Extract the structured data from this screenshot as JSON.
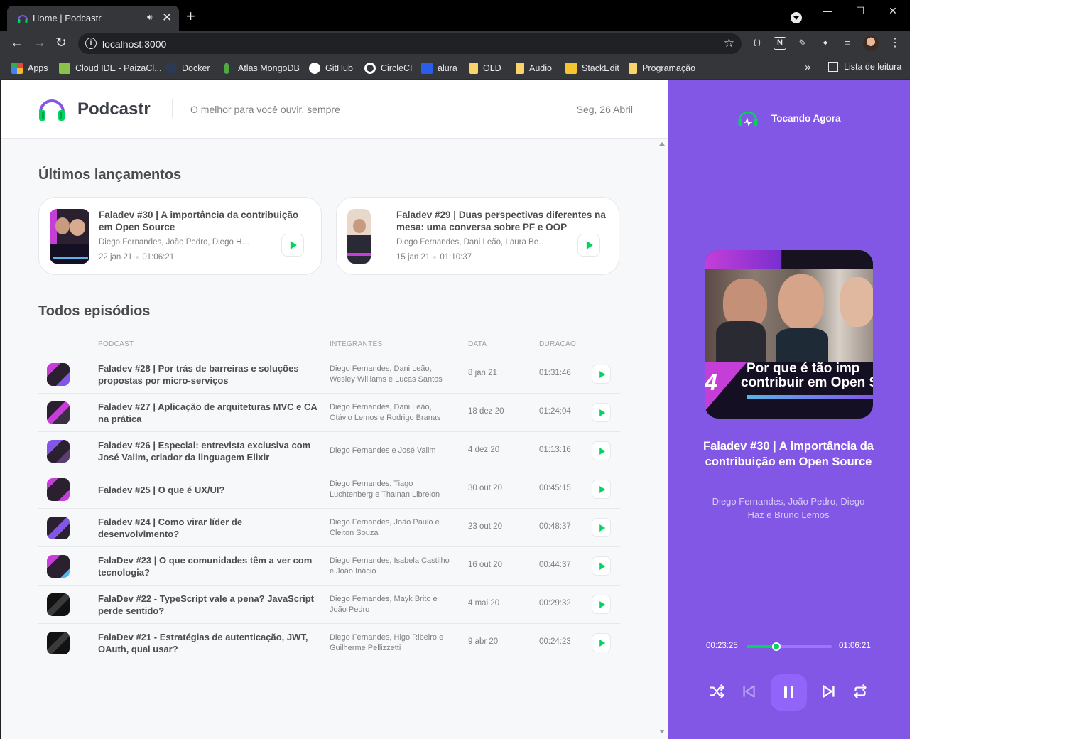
{
  "browser": {
    "tab_title": "Home | Podcastr",
    "url": "localhost:3000",
    "bookmarks": [
      {
        "label": "Apps",
        "icon": "apps-grid-icon",
        "color": "#e8453c"
      },
      {
        "label": "Cloud IDE - PaizaCl...",
        "icon": "paiza-icon",
        "color": "#8bc34a"
      },
      {
        "label": "Docker",
        "icon": "docker-icon",
        "color": "#2b3a55"
      },
      {
        "label": "Atlas MongoDB",
        "icon": "mongodb-leaf-icon",
        "color": "#4faa41"
      },
      {
        "label": "GitHub",
        "icon": "github-icon",
        "color": "#ffffff"
      },
      {
        "label": "CircleCI",
        "icon": "circleci-icon",
        "color": "#ffffff"
      },
      {
        "label": "alura",
        "icon": "alura-icon",
        "color": "#2b5ee8"
      },
      {
        "label": "OLD",
        "icon": "folder-icon",
        "color": "#f9d36b"
      },
      {
        "label": "Audio",
        "icon": "folder-icon",
        "color": "#f9d36b"
      },
      {
        "label": "StackEdit",
        "icon": "stackedit-icon",
        "color": "#f4c431"
      },
      {
        "label": "Programação",
        "icon": "folder-icon",
        "color": "#f9d36b"
      }
    ],
    "reading_list": "Lista de leitura"
  },
  "header": {
    "brand": "Podcastr",
    "tagline": "O melhor para você ouvir, sempre",
    "date": "Seg, 26 Abril"
  },
  "latest": {
    "title": "Últimos lançamentos",
    "episodes": [
      {
        "title": "Faladev #30 | A importância da contribuição em Open Source",
        "members": "Diego Fernandes, João Pedro, Diego Haz e Bruno Lemos",
        "date": "22 jan 21",
        "duration": "01:06:21"
      },
      {
        "title": "Faladev #29 | Duas perspectivas diferentes na mesa: uma conversa sobre PF e OOP",
        "members": "Diego Fernandes, Dani Leão, Laura Beatris e Bruno Lemos",
        "date": "15 jan 21",
        "duration": "01:10:37"
      }
    ]
  },
  "all": {
    "title": "Todos episódios",
    "columns": [
      "Podcast",
      "Integrantes",
      "Data",
      "Duração"
    ],
    "episodes": [
      {
        "title": "Faladev #28 | Por trás de barreiras e soluções propostas por micro-serviços",
        "members": "Diego Fernandes, Dani Leão, Wesley Williams e Lucas Santos",
        "date": "8 jan 21",
        "duration": "01:31:46"
      },
      {
        "title": "Faladev #27 | Aplicação de arquiteturas MVC e CA na prática",
        "members": "Diego Fernandes, Dani Leão, Otávio Lemos e Rodrigo Branas",
        "date": "18 dez 20",
        "duration": "01:24:04"
      },
      {
        "title": "Faladev #26 | Especial: entrevista exclusiva com José Valim, criador da linguagem Elixir",
        "members": "Diego Fernandes e José Valim",
        "date": "4 dez 20",
        "duration": "01:13:16"
      },
      {
        "title": "Faladev #25 | O que é UX/UI?",
        "members": "Diego Fernandes, Tiago Luchtenberg e Thainan Librelon",
        "date": "30 out 20",
        "duration": "00:45:15"
      },
      {
        "title": "Faladev #24 | Como virar líder de desenvolvimento?",
        "members": "Diego Fernandes, João Paulo e Cleiton Souza",
        "date": "23 out 20",
        "duration": "00:48:37"
      },
      {
        "title": "FalaDev #23 | O que comunidades têm a ver com tecnologia?",
        "members": "Diego Fernandes, Isabela Castilho e João Inácio",
        "date": "16 out 20",
        "duration": "00:44:37"
      },
      {
        "title": "FalaDev #22 - TypeScript vale a pena? JavaScript perde sentido?",
        "members": "Diego Fernandes, Mayk Brito e João Pedro",
        "date": "4 mai 20",
        "duration": "00:29:32"
      },
      {
        "title": "FalaDev #21 - Estratégias de autenticação, JWT, OAuth, qual usar?",
        "members": "Diego Fernandes, Higo Ribeiro e Guilherme Pellizzetti",
        "date": "9 abr 20",
        "duration": "00:24:23"
      }
    ]
  },
  "player": {
    "heading": "Tocando Agora",
    "cover_caption_line1": "Por que é tão imp",
    "cover_caption_line2": "contribuir em Open S",
    "cover_number": "4",
    "title": "Faladev #30 | A importância da contribuição em Open Source",
    "members": "Diego Fernandes, João Pedro, Diego Haz e Bruno Lemos",
    "current_time": "00:23:25",
    "total_time": "01:06:21",
    "progress": 0.353,
    "accent": "#8257e5",
    "green": "#04d361"
  }
}
